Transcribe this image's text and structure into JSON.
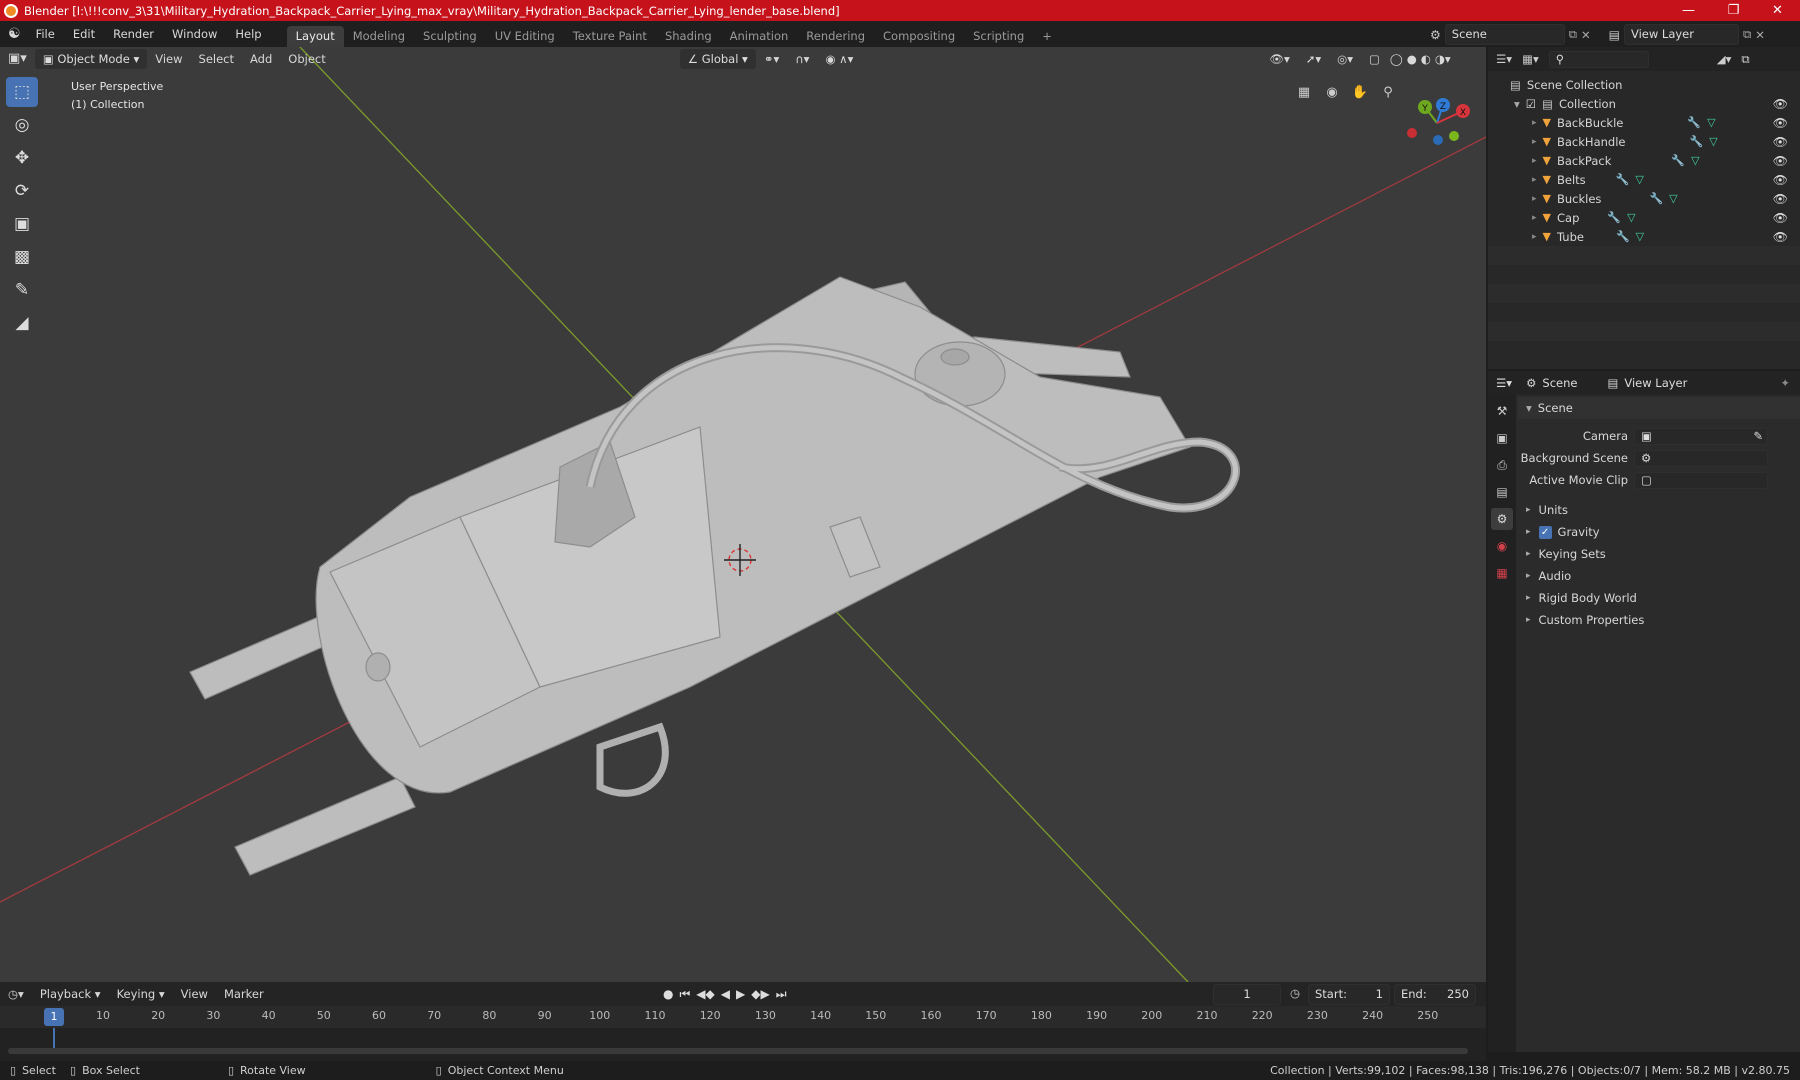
{
  "window": {
    "title": "Blender [I:\\!!!conv_3\\31\\Military_Hydration_Backpack_Carrier_Lying_max_vray\\Military_Hydration_Backpack_Carrier_Lying_lender_base.blend]"
  },
  "menu": [
    "File",
    "Edit",
    "Render",
    "Window",
    "Help"
  ],
  "workspaces": [
    "Layout",
    "Modeling",
    "Sculpting",
    "UV Editing",
    "Texture Paint",
    "Shading",
    "Animation",
    "Rendering",
    "Compositing",
    "Scripting"
  ],
  "workspace_add": "+",
  "scene_field": "Scene",
  "view_layer_field": "View Layer",
  "viewport_header": {
    "mode": "Object Mode",
    "view": "View",
    "select": "Select",
    "add": "Add",
    "object": "Object",
    "orientation": "Global"
  },
  "overlay": {
    "perspective": "User Perspective",
    "collection": "(1) Collection"
  },
  "gizmo": {
    "x": "X",
    "y": "Y",
    "z": "Z"
  },
  "outliner": {
    "root": "Scene Collection",
    "collection": "Collection",
    "objects": [
      "BackBuckle",
      "BackHandle",
      "BackPack",
      "Belts",
      "Buckles",
      "Cap",
      "Tube"
    ]
  },
  "properties": {
    "tab_scene": "Scene",
    "tab_view_layer": "View Layer",
    "panel_title": "Scene",
    "camera_label": "Camera",
    "background_scene_label": "Background Scene",
    "active_movie_clip_label": "Active Movie Clip",
    "sections": [
      "Units",
      "Gravity",
      "Keying Sets",
      "Audio",
      "Rigid Body World",
      "Custom Properties"
    ],
    "gravity_checked": true
  },
  "timeline": {
    "playback": "Playback",
    "keying": "Keying",
    "view": "View",
    "marker": "Marker",
    "current_frame": "1",
    "start_label": "Start:",
    "start": "1",
    "end_label": "End:",
    "end": "250",
    "ruler_current": "1",
    "ticks": [
      "10",
      "20",
      "30",
      "40",
      "50",
      "60",
      "70",
      "80",
      "90",
      "100",
      "110",
      "120",
      "130",
      "140",
      "150",
      "160",
      "170",
      "180",
      "190",
      "200",
      "210",
      "220",
      "230",
      "240",
      "250"
    ]
  },
  "status": {
    "select": "Select",
    "box_select": "Box Select",
    "rotate_view": "Rotate View",
    "context_menu": "Object Context Menu",
    "stats": "Collection | Verts:99,102 | Faces:98,138 | Tris:196,276 | Objects:0/7 | Mem: 58.2 MB | v2.80.75"
  },
  "colors": {
    "title_bar": "#c5121b",
    "accent": "#4772b3",
    "object_icon": "#f0a33a",
    "x_axis": "#d8343b",
    "y_axis": "#7ab71e"
  }
}
